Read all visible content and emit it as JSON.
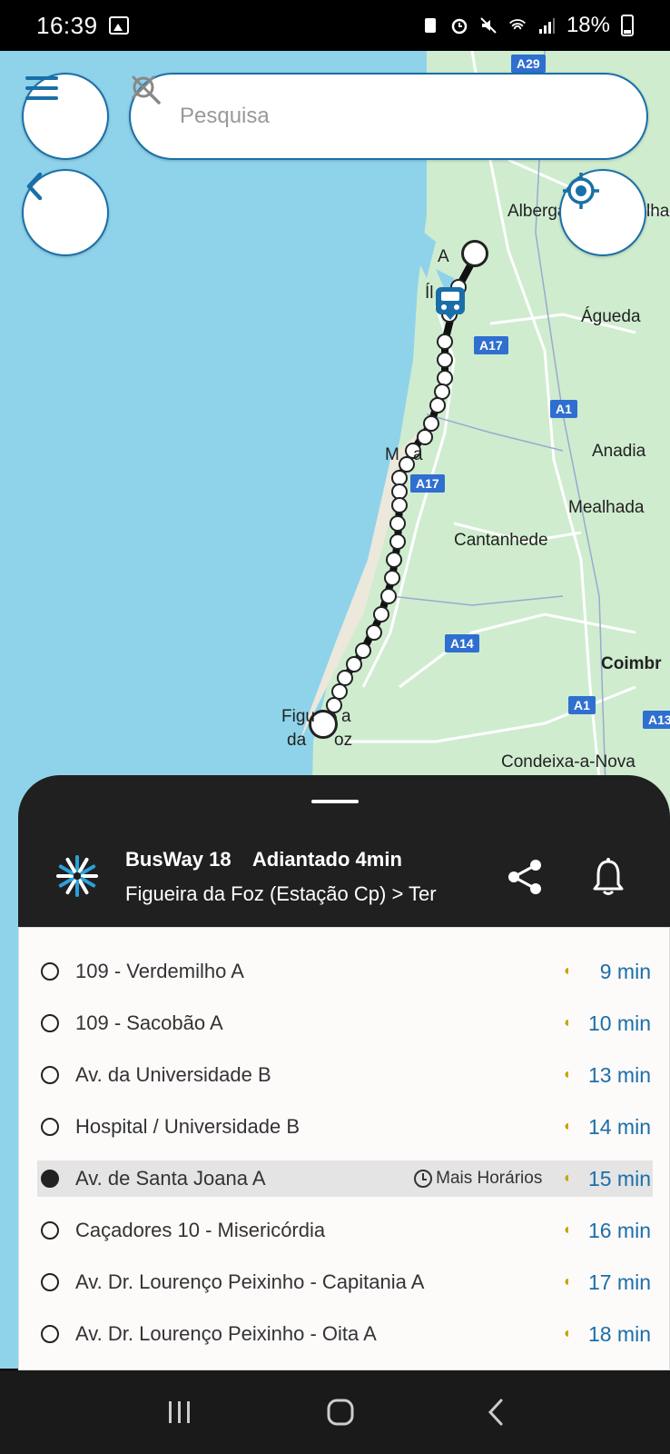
{
  "status_bar": {
    "time": "16:39",
    "battery": "18%"
  },
  "search": {
    "placeholder": "Pesquisa"
  },
  "map": {
    "labels": {
      "albergaria": "Alberga",
      "albergaria_suffix": "lha",
      "agueda": "Águeda",
      "anadia": "Anadia",
      "mealhada": "Mealhada",
      "cantanhede": "Cantanhede",
      "coimbra": "Coimbr",
      "condeixa": "Condeixa-a-Nova",
      "figueira_1": "Figu",
      "figueira_1b": "a",
      "figueira_2": "da",
      "figueira_2b": "oz",
      "mira": "M",
      "mira_b": "a",
      "ilhavo": "Íl",
      "aveiro": "A"
    },
    "roads": {
      "a29": "A29",
      "a17_north": "A17",
      "a17_south": "A17",
      "a1_north": "A1",
      "a1_south": "A1",
      "a14": "A14",
      "a13": "A13"
    }
  },
  "line": {
    "name": "BusWay 18",
    "status": "Adiantado 4min",
    "destination": "Figueira da Foz (Estação Cp) > Ter"
  },
  "stops": [
    {
      "name": "109 - Verdemilho A",
      "eta": "9 min",
      "selected": false
    },
    {
      "name": "109 - Sacobão A",
      "eta": "10 min",
      "selected": false
    },
    {
      "name": "Av. da Universidade B",
      "eta": "13 min",
      "selected": false
    },
    {
      "name": "Hospital / Universidade B",
      "eta": "14 min",
      "selected": false
    },
    {
      "name": "Av. de Santa Joana A",
      "eta": "15 min",
      "selected": true,
      "more_times": "Mais Horários"
    },
    {
      "name": "Caçadores 10 - Misericórdia",
      "eta": "16 min",
      "selected": false
    },
    {
      "name": "Av. Dr. Lourenço Peixinho - Capitania A",
      "eta": "17 min",
      "selected": false
    },
    {
      "name": "Av. Dr. Lourenço Peixinho - Oita A",
      "eta": "18 min",
      "selected": false
    }
  ],
  "colors": {
    "accent": "#1a6fa8",
    "sea": "#8fd3ea",
    "land": "#cfeccf",
    "sheet": "#202020",
    "live": "#c8a400"
  }
}
